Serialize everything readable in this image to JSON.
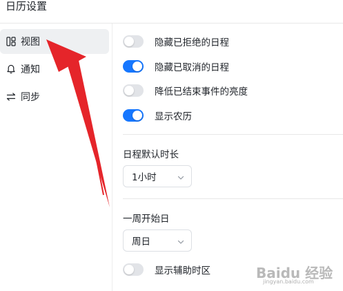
{
  "window": {
    "title": "日历设置"
  },
  "sidebar": {
    "items": [
      {
        "label": "视图",
        "icon": "layout-icon",
        "active": true
      },
      {
        "label": "通知",
        "icon": "bell-icon",
        "active": false
      },
      {
        "label": "同步",
        "icon": "sync-icon",
        "active": false
      }
    ]
  },
  "view_settings": {
    "hide_rejected": {
      "label": "隐藏已拒绝的日程",
      "on": false
    },
    "hide_cancelled": {
      "label": "隐藏已取消的日程",
      "on": true
    },
    "dim_ended": {
      "label": "降低已结束事件的亮度",
      "on": false
    },
    "show_lunar": {
      "label": "显示农历",
      "on": true
    },
    "default_duration": {
      "label": "日程默认时长",
      "value": "1小时"
    },
    "week_start": {
      "label": "一周开始日",
      "value": "周日"
    },
    "secondary_timezone": {
      "label": "显示辅助时区",
      "on": false
    }
  },
  "colors": {
    "accent": "#1677ff",
    "toggle_off": "#e2e4e8",
    "annotation_arrow": "#e5252a"
  },
  "watermark": {
    "text": "Baidu 经验",
    "sub": "jingyan.baidu.com"
  }
}
